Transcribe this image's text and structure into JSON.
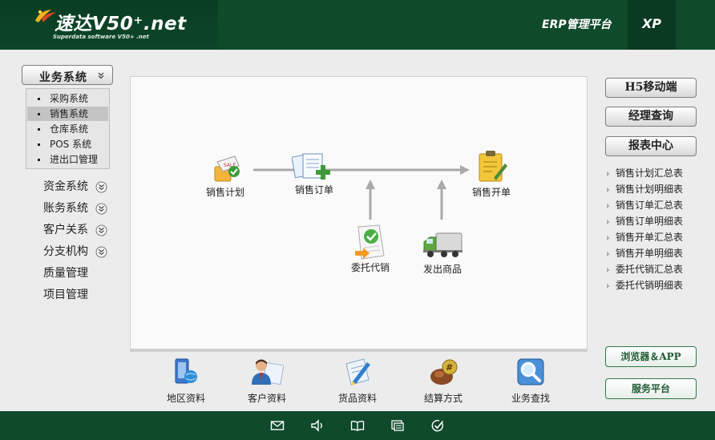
{
  "header": {
    "logo_title": "速达V50⁺.net",
    "logo_subtitle": "Superdata software V50+ .net",
    "platform": "ERP管理平台",
    "xp_label": "XP"
  },
  "sidebar": {
    "system_button": "业务系统",
    "submenu": [
      {
        "label": "采购系统"
      },
      {
        "label": "销售系统",
        "active": true
      },
      {
        "label": "仓库系统"
      },
      {
        "label": "POS 系统"
      },
      {
        "label": "进出口管理"
      }
    ],
    "items": [
      {
        "label": "资金系统",
        "expandable": true
      },
      {
        "label": "账务系统",
        "expandable": true
      },
      {
        "label": "客户关系",
        "expandable": true
      },
      {
        "label": "分支机构",
        "expandable": true
      },
      {
        "label": "质量管理",
        "expandable": false
      },
      {
        "label": "项目管理",
        "expandable": false
      }
    ]
  },
  "flow": {
    "sales_plan": "销售计划",
    "sales_order": "销售订单",
    "sales_invoice": "销售开单",
    "consignment": "委托代销",
    "ship_goods": "发出商品"
  },
  "tools": [
    {
      "label": "地区资料",
      "icon": "region-data-icon"
    },
    {
      "label": "客户资料",
      "icon": "customer-data-icon"
    },
    {
      "label": "货品资料",
      "icon": "goods-data-icon"
    },
    {
      "label": "结算方式",
      "icon": "settlement-method-icon"
    },
    {
      "label": "业务查找",
      "icon": "business-search-icon"
    }
  ],
  "right": {
    "h5_mobile": "H5移动端",
    "manager_query": "经理查询",
    "report_center": "报表中心",
    "reports": [
      "销售计划汇总表",
      "销售计划明细表",
      "销售订单汇总表",
      "销售订单明细表",
      "销售开单汇总表",
      "销售开单明细表",
      "委托代销汇总表",
      "委托代销明细表"
    ],
    "browser_app": "浏览器＆APP",
    "service_platform": "服务平台"
  },
  "footer": {
    "icons": [
      "mail-icon",
      "speaker-icon",
      "book-icon",
      "window-icon",
      "check-circle-icon"
    ]
  },
  "colors": {
    "header_green": "#0f4a2b",
    "accent_green": "#2f7a48",
    "background": "#ececec"
  }
}
